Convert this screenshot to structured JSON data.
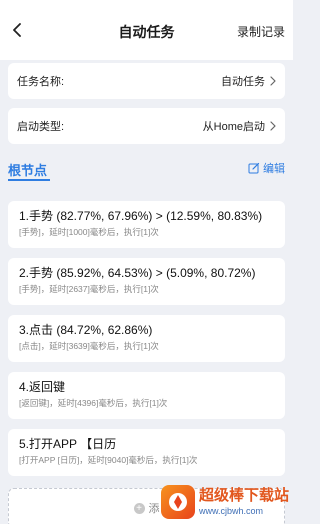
{
  "header": {
    "title": "自动任务",
    "record_label": "录制记录"
  },
  "settings": [
    {
      "label": "任务名称:",
      "value": "自动任务"
    },
    {
      "label": "启动类型:",
      "value": "从Home启动"
    }
  ],
  "section": {
    "title": "根节点",
    "edit_label": "编辑"
  },
  "nodes": [
    {
      "name": "1.手势 (82.77%, 67.96%) > (12.59%, 80.83%)",
      "detail": "[手势]，延时[1000]毫秒后，执行[1]次"
    },
    {
      "name": "2.手势 (85.92%, 64.53%) > (5.09%, 80.72%)",
      "detail": "[手势]，延时[2637]毫秒后，执行[1]次"
    },
    {
      "name": "3.点击 (84.72%, 62.86%)",
      "detail": "[点击]，延时[3639]毫秒后，执行[1]次"
    },
    {
      "name": "4.返回键",
      "detail": "[返回键]，延时[4396]毫秒后，执行[1]次"
    },
    {
      "name": "5.打开APP 【日历",
      "detail": "[打开APP [日历]，延时[9040]毫秒后，执行[1]次"
    }
  ],
  "add": {
    "label": "添"
  },
  "watermark": {
    "name": "超级棒下载站",
    "url": "www.cjbwh.com"
  },
  "colors": {
    "accent": "#2f7de1",
    "background": "#eef0f5",
    "card": "#ffffff",
    "watermark_orange": "#e2571e"
  }
}
